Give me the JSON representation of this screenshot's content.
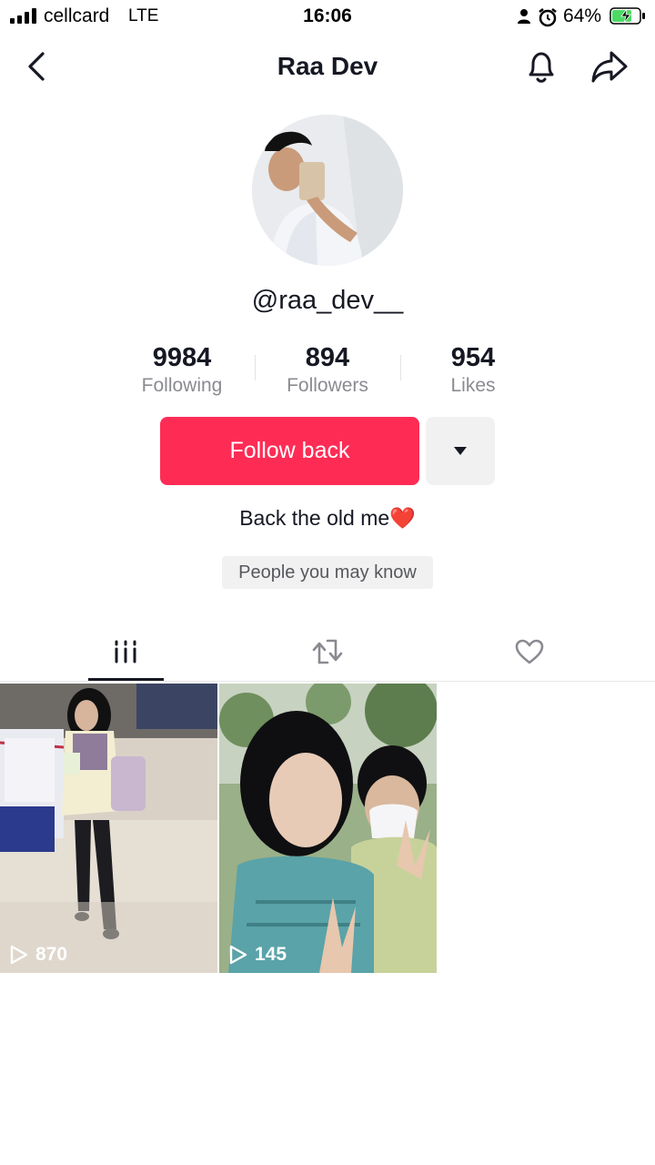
{
  "status_bar": {
    "carrier": "cellcard",
    "network": "LTE",
    "time": "16:06",
    "battery": "64%"
  },
  "nav": {
    "title": "Raa Dev",
    "back_icon": "chevron-left-icon",
    "bell_icon": "bell-icon",
    "share_icon": "share-arrow-icon"
  },
  "profile": {
    "username": "@raa_dev__",
    "stats": [
      {
        "value": "9984",
        "label": "Following"
      },
      {
        "value": "894",
        "label": "Followers"
      },
      {
        "value": "954",
        "label": "Likes"
      }
    ],
    "follow_label": "Follow back",
    "bio": "Back the old me❤️",
    "people_you_may_know": "People you may know"
  },
  "tabs": [
    {
      "icon": "videos-grid-icon",
      "active": true
    },
    {
      "icon": "repost-icon",
      "active": false
    },
    {
      "icon": "liked-heart-icon",
      "active": false
    }
  ],
  "videos": [
    {
      "views": "870"
    },
    {
      "views": "145"
    }
  ],
  "colors": {
    "accent": "#fe2c55",
    "text": "#161823",
    "muted": "#8a8b91"
  }
}
